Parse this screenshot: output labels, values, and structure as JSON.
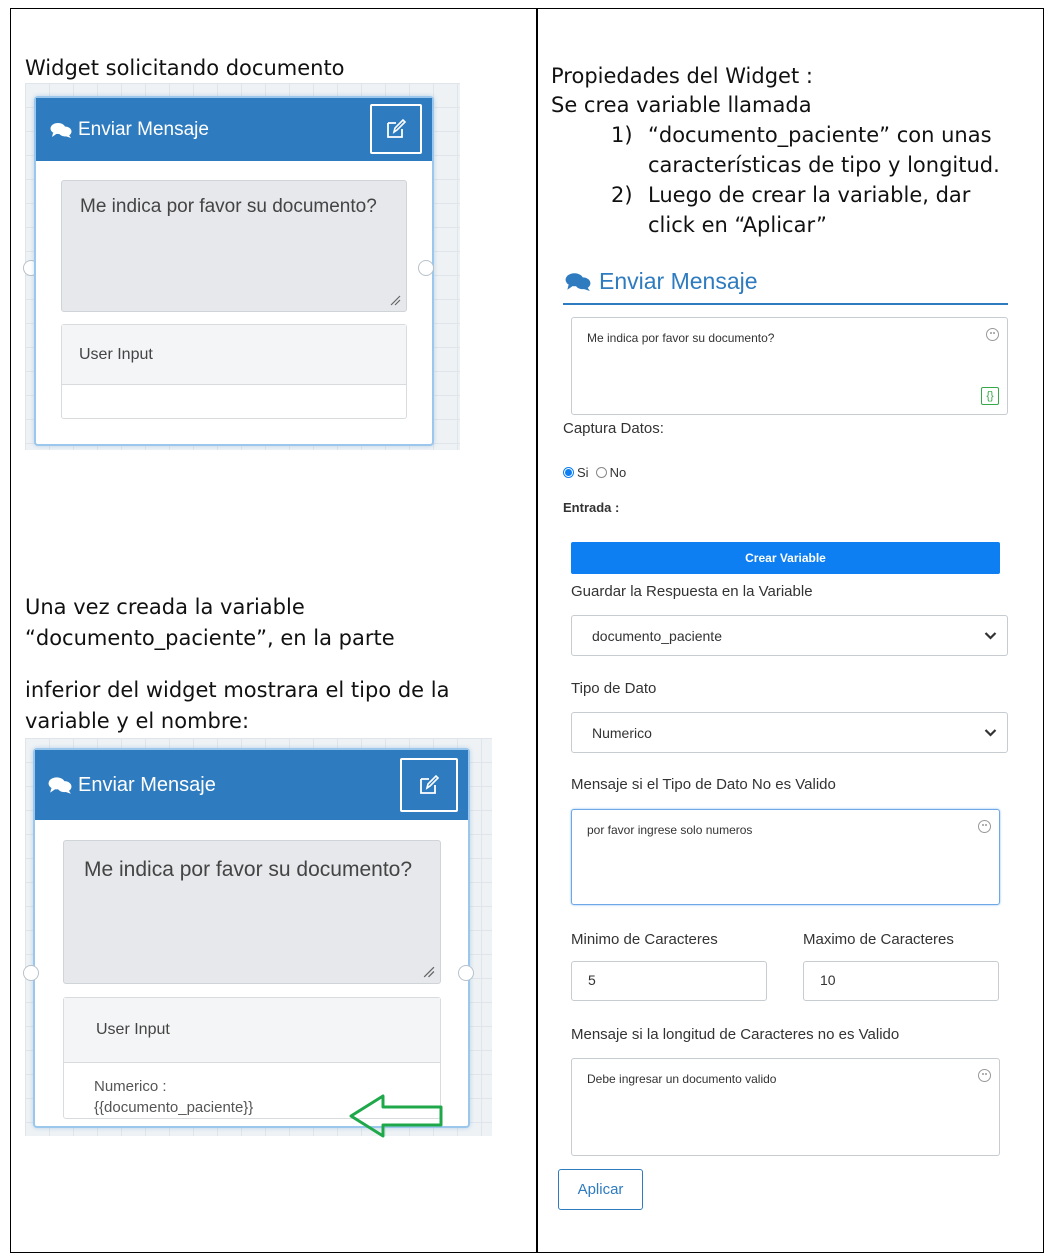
{
  "left": {
    "caption_top": "Widget  solicitando documento",
    "caption_bottom": [
      "Una vez creada la variable",
      "“documento_paciente”, en la parte",
      "inferior del widget mostrara el tipo de la",
      "variable y el nombre:"
    ],
    "widget_1": {
      "title": "Enviar Mensaje",
      "message": "Me indica por favor su documento?",
      "input_label": "User Input"
    },
    "widget_2": {
      "title": "Enviar Mensaje",
      "message": "Me indica por favor su documento?",
      "input_label": "User Input",
      "variable_type": "Numerico :",
      "variable_name": "{{documento_paciente}}"
    }
  },
  "right": {
    "intro_1": "Propiedades del Widget :",
    "intro_2": "Se crea variable llamada",
    "steps": [
      {
        "num": "1)",
        "line1": "“documento_paciente” con unas",
        "line2": "características de tipo y longitud."
      },
      {
        "num": "2)",
        "line1": "Luego de crear la variable, dar",
        "line2": "click en “Aplicar”"
      }
    ],
    "panel": {
      "title": "Enviar Mensaje",
      "message": "Me indica por favor su documento?",
      "captura_label": "Captura Datos:",
      "radio_si": "Si",
      "radio_no": "No",
      "entrada_label": "Entrada :",
      "crear_variable": "Crear Variable",
      "guardar_label": "Guardar la Respuesta en la Variable",
      "guardar_value": "documento_paciente",
      "tipo_label": "Tipo de Dato",
      "tipo_value": "Numerico",
      "invalid_type_label": "Mensaje si el Tipo de Dato No es Valido",
      "invalid_type_msg": "por favor ingrese solo numeros",
      "min_label": "Minimo de Caracteres",
      "max_label": "Maximo de Caracteres",
      "min_value": "5",
      "max_value": "10",
      "invalid_len_label": "Mensaje si la longitud de Caracteres no es Valido",
      "invalid_len_msg": "Debe ingresar un documento valido",
      "aplicar": "Aplicar"
    }
  },
  "colors": {
    "header_blue": "#2e7bbf",
    "button_blue": "#0d7ff2",
    "arrow_green": "#1fa84a"
  }
}
